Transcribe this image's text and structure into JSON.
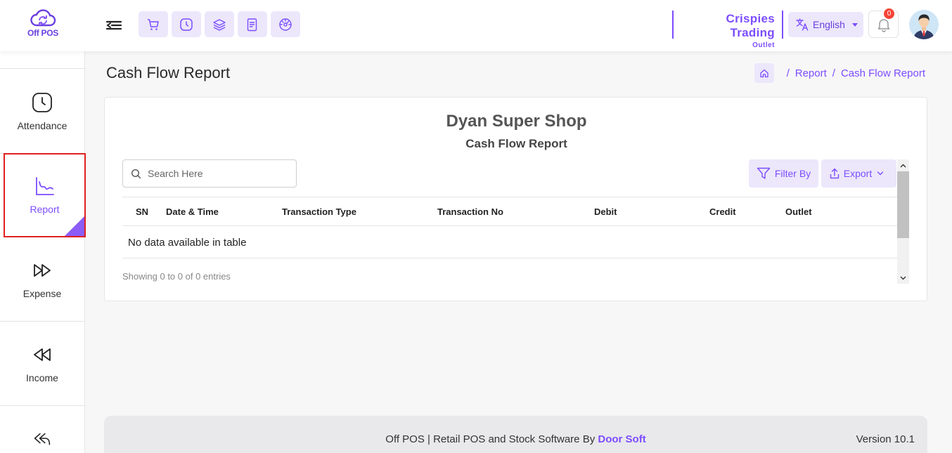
{
  "app": {
    "logo_text": "Off POS"
  },
  "header": {
    "company_name": "Crispies Trading",
    "company_sub": "Outlet",
    "language": "English",
    "notifications": "0",
    "quick_actions": [
      "cart-icon",
      "clock-icon",
      "layers-icon",
      "document-icon",
      "dashboard-icon"
    ]
  },
  "sidebar": {
    "items": [
      {
        "label": "Attendance",
        "icon": "clock-icon"
      },
      {
        "label": "Report",
        "icon": "chart-icon",
        "active": true
      },
      {
        "label": "Expense",
        "icon": "forward-icon"
      },
      {
        "label": "Income",
        "icon": "rewind-icon"
      },
      {
        "label": "",
        "icon": "reply-all-icon"
      }
    ]
  },
  "page": {
    "title": "Cash Flow Report",
    "breadcrumb": [
      "Report",
      "Cash Flow Report"
    ]
  },
  "report": {
    "shop_name": "Dyan Super Shop",
    "title": "Cash Flow Report",
    "search_placeholder": "Search Here",
    "filter_label": "Filter By",
    "export_label": "Export",
    "columns": [
      "SN",
      "Date & Time",
      "Transaction Type",
      "Transaction No",
      "Debit",
      "Credit",
      "Outlet"
    ],
    "empty_text": "No data available in table",
    "info": "Showing 0 to 0 of 0 entries"
  },
  "footer": {
    "text": "Off POS | Retail POS and Stock Software By ",
    "brand": "Door Soft",
    "version": "Version 10.1"
  },
  "colors": {
    "accent": "#7c4dff",
    "accent_light": "#ece7fb",
    "badge": "#f44336",
    "active_border": "#e02020"
  }
}
